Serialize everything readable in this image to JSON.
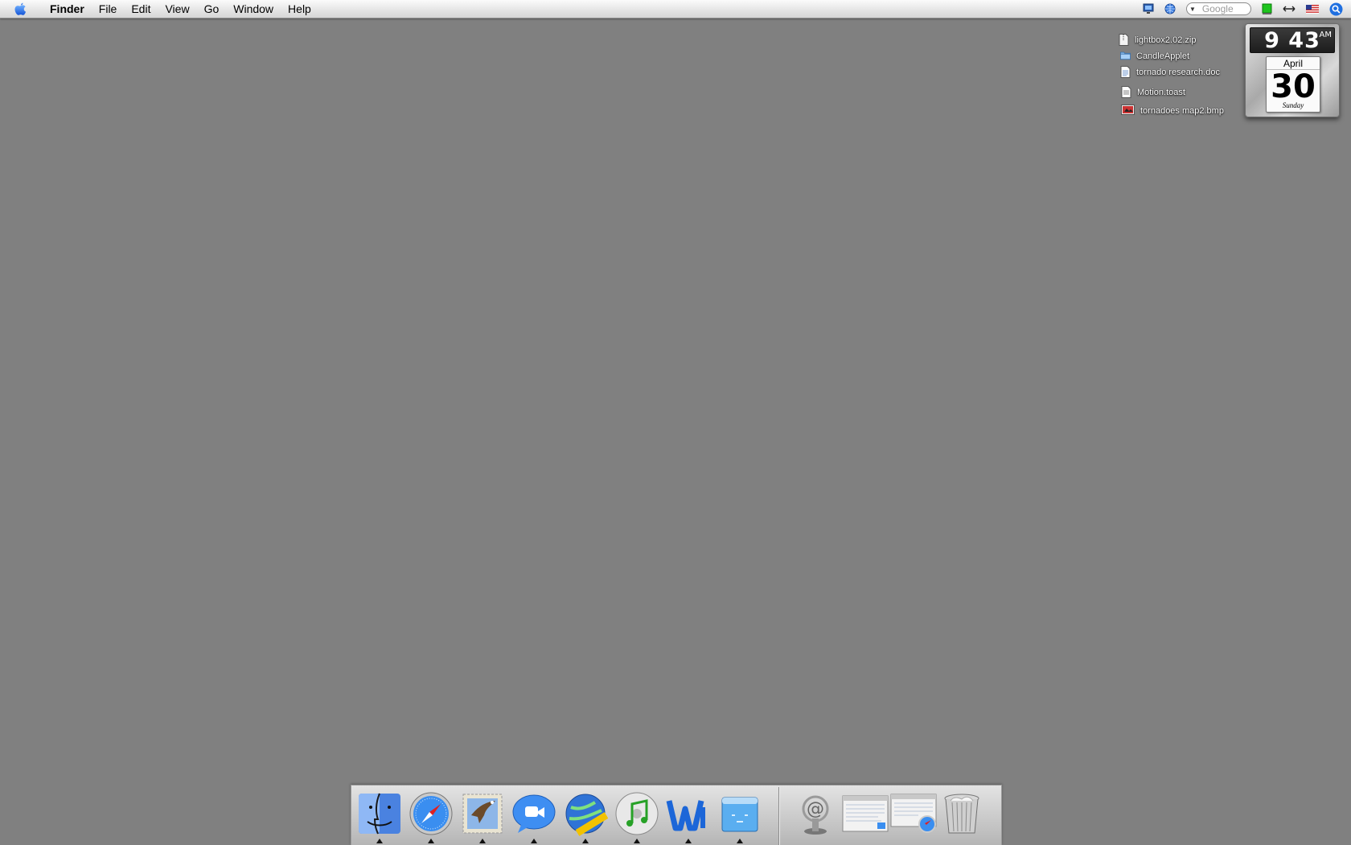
{
  "menubar": {
    "app_name": "Finder",
    "items": [
      "File",
      "Edit",
      "View",
      "Go",
      "Window",
      "Help"
    ],
    "search_placeholder": "Google"
  },
  "desktop_items": [
    {
      "label": "lightbox2.02.zip",
      "icon": "zip-file-icon"
    },
    {
      "label": "CandleApplet",
      "icon": "folder-icon"
    },
    {
      "label": "tornado research.doc",
      "icon": "document-icon"
    },
    {
      "label": "Motion.toast",
      "icon": "document-icon"
    },
    {
      "label": "tornadoes map2.bmp",
      "icon": "image-file-icon"
    }
  ],
  "widget": {
    "time": "9 43",
    "ampm": "AM",
    "month": "April",
    "day": "30",
    "weekday": "Sunday"
  },
  "dock": {
    "apps": [
      "finder-icon",
      "safari-icon",
      "mail-icon",
      "ichat-icon",
      "network-icon",
      "itunes-icon",
      "word-icon",
      "folder-app-icon"
    ],
    "others": [
      "mail-stack-icon",
      "window-thumbnail-icon",
      "safari-window-icon",
      "trash-icon"
    ]
  },
  "colors": {
    "desktop": "#808080",
    "menubar": "#e8e8e8"
  }
}
